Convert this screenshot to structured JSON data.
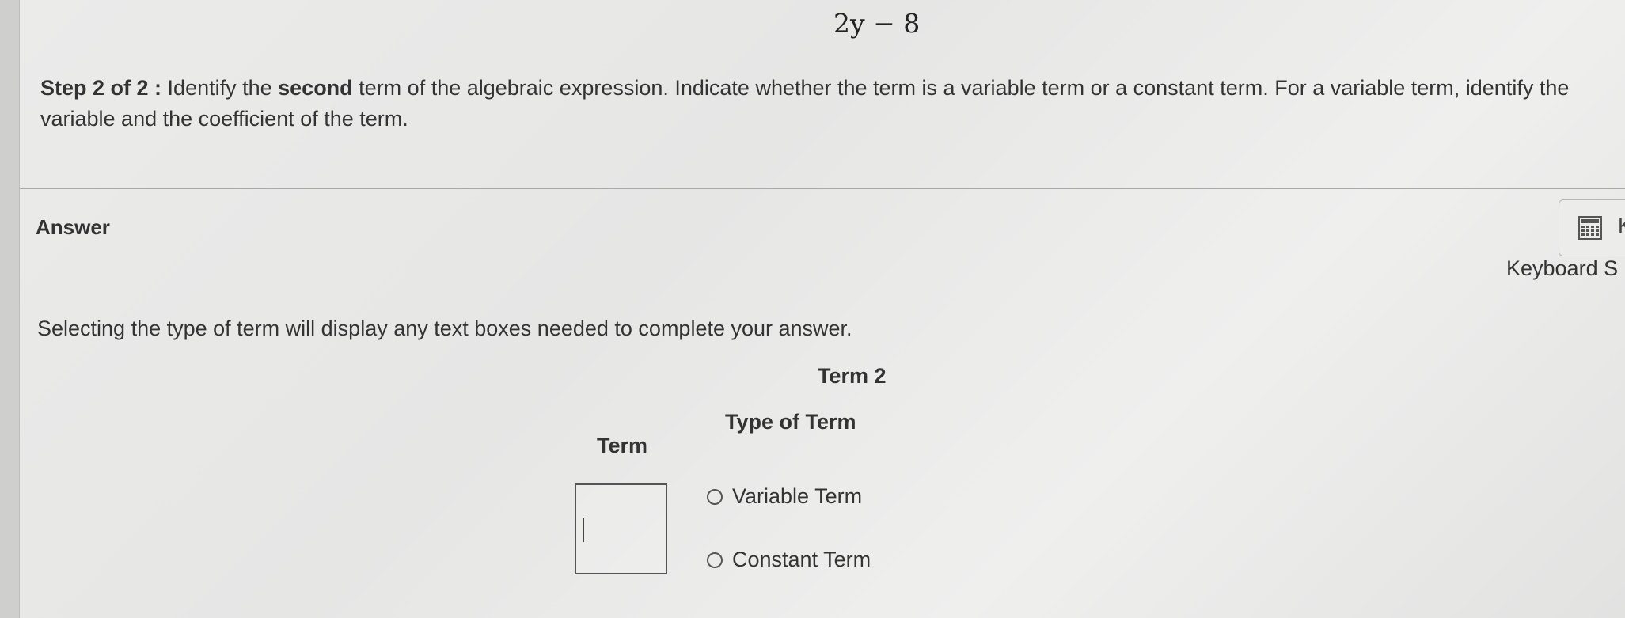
{
  "problem": {
    "expression": "2y − 8",
    "step_label": "Step 2 of 2 :",
    "instruction_before_bold": "Identify the ",
    "instruction_bold": "second",
    "instruction_after_bold": " term of the algebraic expression. Indicate whether the term is a variable term or a constant term. For a variable term, identify the",
    "instruction_line2": "variable and the coefficient of the term."
  },
  "answer": {
    "heading": "Answer",
    "keyboard_button_letter": "K",
    "keyboard_shortcuts_label": "Keyboard S",
    "instruction": "Selecting the type of term will display any text boxes needed to complete your answer.",
    "term_title": "Term 2",
    "column_type": "Type of Term",
    "column_term": "Term",
    "term_input_value": "",
    "options": [
      {
        "label": "Variable Term",
        "selected": false
      },
      {
        "label": "Constant Term",
        "selected": false
      }
    ]
  },
  "icons": {
    "keyboard": "keyboard-grid-icon",
    "radio": "radio-button-icon"
  }
}
